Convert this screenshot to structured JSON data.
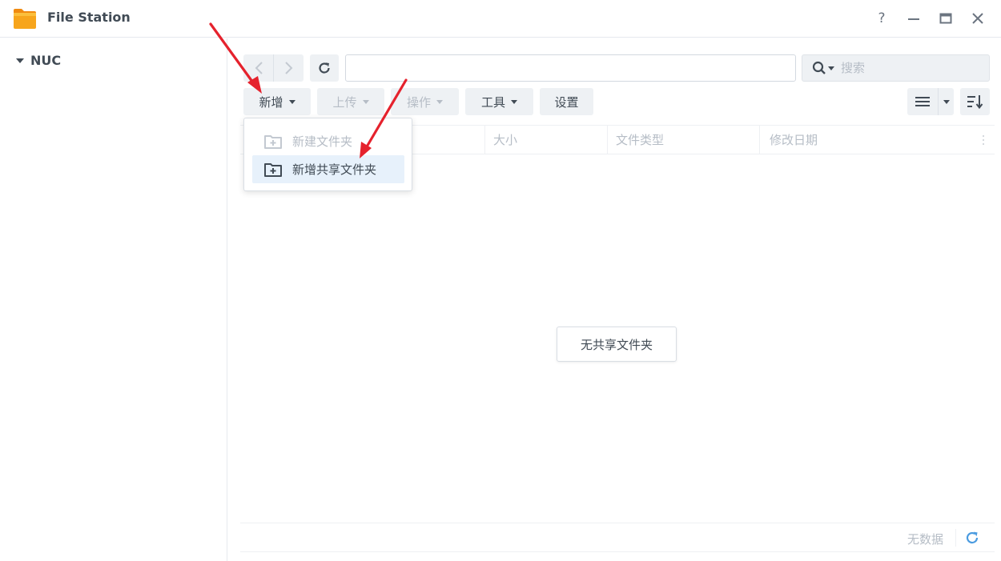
{
  "window": {
    "title": "File Station",
    "help_label": "?"
  },
  "sidebar": {
    "root_label": "NUC"
  },
  "toolbar": {
    "search_placeholder": "搜索",
    "path_value": "",
    "buttons": {
      "new": "新增",
      "upload": "上传",
      "action": "操作",
      "tools": "工具",
      "settings": "设置"
    }
  },
  "dropdown": {
    "items": [
      {
        "label": "新建文件夹",
        "state": "disabled"
      },
      {
        "label": "新增共享文件夹",
        "state": "active"
      }
    ]
  },
  "columns": {
    "name": "",
    "size": "大小",
    "type": "文件类型",
    "modified": "修改日期"
  },
  "content": {
    "empty_message": "无共享文件夹"
  },
  "footer": {
    "status": "无数据"
  },
  "colors": {
    "accent": "#4a9be0",
    "arrow": "#e5222d",
    "folder": "#f7a51c"
  }
}
